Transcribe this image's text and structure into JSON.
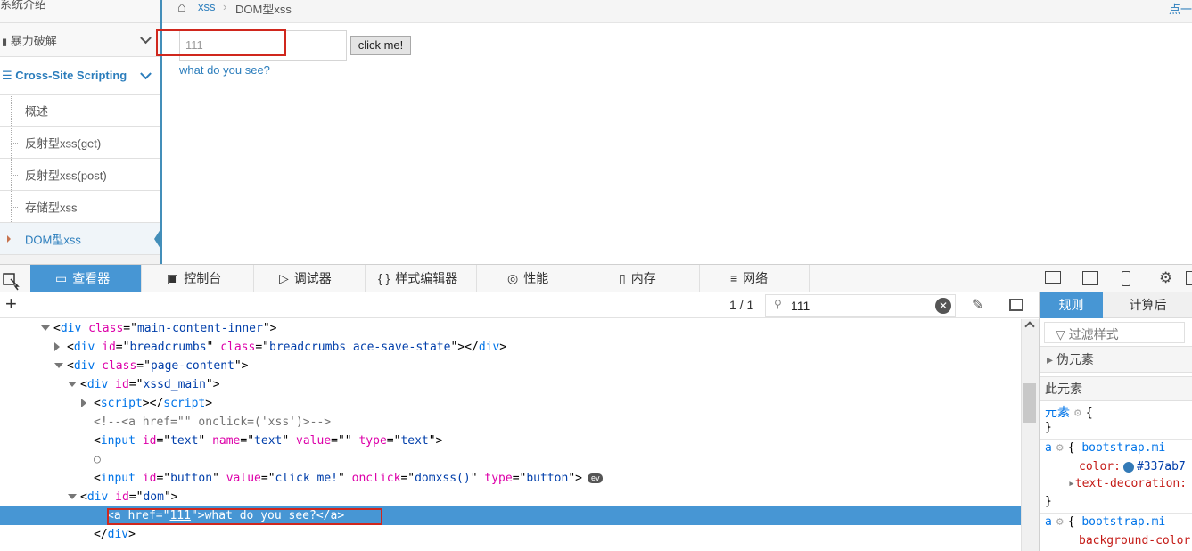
{
  "sidebar": {
    "top_item": "系统介绍",
    "brute": "暴力破解",
    "xss": "Cross-Site Scripting",
    "subitems": [
      "概述",
      "反射型xss(get)",
      "反射型xss(post)",
      "存储型xss",
      "DOM型xss"
    ]
  },
  "breadcrumb": {
    "link": "xss",
    "current": "DOM型xss",
    "right": "点一"
  },
  "form": {
    "input_value": "111",
    "button_label": "click me!",
    "link_text": "what do you see?"
  },
  "devtools": {
    "tabs": [
      "查看器",
      "控制台",
      "调试器",
      "样式编辑器",
      "性能",
      "内存",
      "网络"
    ],
    "search_count": "1 / 1",
    "search_value": "111",
    "right_tabs": [
      "规则",
      "计算后"
    ],
    "filter_placeholder": "过滤样式",
    "pseudo_section": "伪元素",
    "this_element": "此元素",
    "element_label": "元素",
    "rule_selector": "a",
    "rule_source": "bootstrap.mi",
    "prop_color": "color:",
    "prop_color_value": "#337ab7",
    "prop_text_decoration": "text-decoration:",
    "prop_background": "background-color",
    "accent_color": "#4796d4"
  },
  "code_lines": [
    {
      "indent": 4,
      "twisty": "down",
      "parts": [
        [
          "p",
          "<"
        ],
        [
          "t",
          "div"
        ],
        [
          "p",
          " "
        ],
        [
          "a",
          "class"
        ],
        [
          "p",
          "=\""
        ],
        [
          "v",
          "main-content-inner"
        ],
        [
          "p",
          "\">"
        ]
      ]
    },
    {
      "indent": 5,
      "twisty": "right",
      "parts": [
        [
          "p",
          "<"
        ],
        [
          "t",
          "div"
        ],
        [
          "p",
          " "
        ],
        [
          "a",
          "id"
        ],
        [
          "p",
          "=\""
        ],
        [
          "v",
          "breadcrumbs"
        ],
        [
          "p",
          "\" "
        ],
        [
          "a",
          "class"
        ],
        [
          "p",
          "=\""
        ],
        [
          "v",
          "breadcrumbs ace-save-state"
        ],
        [
          "p",
          "\"></"
        ],
        [
          "t",
          "div"
        ],
        [
          "p",
          ">"
        ]
      ]
    },
    {
      "indent": 5,
      "twisty": "down",
      "parts": [
        [
          "p",
          "<"
        ],
        [
          "t",
          "div"
        ],
        [
          "p",
          " "
        ],
        [
          "a",
          "class"
        ],
        [
          "p",
          "=\""
        ],
        [
          "v",
          "page-content"
        ],
        [
          "p",
          "\">"
        ]
      ]
    },
    {
      "indent": 6,
      "twisty": "down",
      "parts": [
        [
          "p",
          "<"
        ],
        [
          "t",
          "div"
        ],
        [
          "p",
          " "
        ],
        [
          "a",
          "id"
        ],
        [
          "p",
          "=\""
        ],
        [
          "v",
          "xssd_main"
        ],
        [
          "p",
          "\">"
        ]
      ]
    },
    {
      "indent": 7,
      "twisty": "right",
      "parts": [
        [
          "p",
          "<"
        ],
        [
          "t",
          "script"
        ],
        [
          "p",
          "></"
        ],
        [
          "t",
          "script"
        ],
        [
          "p",
          ">"
        ]
      ]
    },
    {
      "indent": 7,
      "twisty": "",
      "parts": [
        [
          "c",
          "<!--<a href=\"\" onclick=('xss')>-->"
        ]
      ]
    },
    {
      "indent": 7,
      "twisty": "",
      "parts": [
        [
          "p",
          "<"
        ],
        [
          "t",
          "input"
        ],
        [
          "p",
          " "
        ],
        [
          "a",
          "id"
        ],
        [
          "p",
          "=\""
        ],
        [
          "v",
          "text"
        ],
        [
          "p",
          "\" "
        ],
        [
          "a",
          "name"
        ],
        [
          "p",
          "=\""
        ],
        [
          "v",
          "text"
        ],
        [
          "p",
          "\" "
        ],
        [
          "a",
          "value"
        ],
        [
          "p",
          "=\"\" "
        ],
        [
          "a",
          "type"
        ],
        [
          "p",
          "=\""
        ],
        [
          "v",
          "text"
        ],
        [
          "p",
          "\">"
        ]
      ]
    },
    {
      "indent": 7,
      "twisty": "",
      "parts": [
        [
          "c",
          "○"
        ]
      ]
    },
    {
      "indent": 7,
      "twisty": "",
      "ev": true,
      "parts": [
        [
          "p",
          "<"
        ],
        [
          "t",
          "input"
        ],
        [
          "p",
          " "
        ],
        [
          "a",
          "id"
        ],
        [
          "p",
          "=\""
        ],
        [
          "v",
          "button"
        ],
        [
          "p",
          "\" "
        ],
        [
          "a",
          "value"
        ],
        [
          "p",
          "=\""
        ],
        [
          "v",
          "click me!"
        ],
        [
          "p",
          "\" "
        ],
        [
          "a",
          "onclick"
        ],
        [
          "p",
          "=\""
        ],
        [
          "v",
          "domxss()"
        ],
        [
          "p",
          "\" "
        ],
        [
          "a",
          "type"
        ],
        [
          "p",
          "=\""
        ],
        [
          "v",
          "button"
        ],
        [
          "p",
          "\">"
        ]
      ]
    },
    {
      "indent": 6,
      "twisty": "down",
      "parts": [
        [
          "p",
          "<"
        ],
        [
          "t",
          "div"
        ],
        [
          "p",
          " "
        ],
        [
          "a",
          "id"
        ],
        [
          "p",
          "=\""
        ],
        [
          "v",
          "dom"
        ],
        [
          "p",
          "\">"
        ]
      ]
    },
    {
      "indent": 8,
      "twisty": "",
      "selected": true,
      "parts": [
        [
          "p",
          "<"
        ],
        [
          "t",
          "a"
        ],
        [
          "p",
          " "
        ],
        [
          "a",
          "href"
        ],
        [
          "p",
          "=\""
        ],
        [
          "u",
          "111"
        ],
        [
          "p",
          "\">what do you see?</"
        ],
        [
          "t",
          "a"
        ],
        [
          "p",
          ">"
        ]
      ]
    },
    {
      "indent": 7,
      "twisty": "",
      "parts": [
        [
          "p",
          "</"
        ],
        [
          "t",
          "div"
        ],
        [
          "p",
          ">"
        ]
      ]
    }
  ]
}
